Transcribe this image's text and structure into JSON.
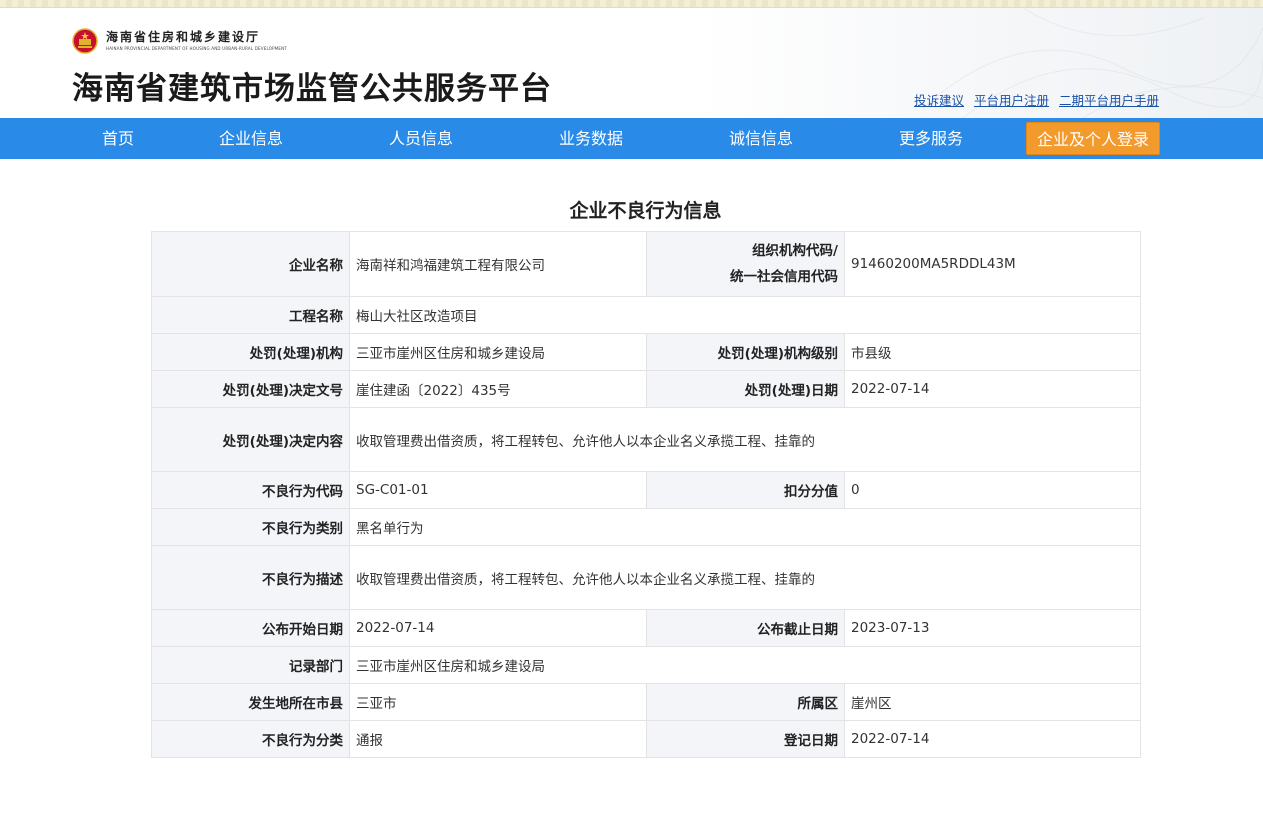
{
  "header": {
    "dept_name_cn": "海南省住房和城乡建设厅",
    "dept_name_en": "HAINAN PROVINCIAL DEPARTMENT OF HOUSING AND URBAN-RURAL DEVELOPMENT",
    "site_title": "海南省建筑市场监管公共服务平台",
    "links": [
      "投诉建议",
      "平台用户注册",
      "二期平台用户手册"
    ]
  },
  "nav": {
    "items": [
      "首页",
      "企业信息",
      "人员信息",
      "业务数据",
      "诚信信息",
      "更多服务"
    ],
    "login": "企业及个人登录"
  },
  "page": {
    "heading": "企业不良行为信息"
  },
  "labels": {
    "company_name": "企业名称",
    "org_code_line1": "组织机构代码/",
    "org_code_line2": "统一社会信用代码",
    "project_name": "工程名称",
    "penalty_agency": "处罚(处理)机构",
    "agency_level": "处罚(处理)机构级别",
    "decision_no": "处罚(处理)决定文号",
    "penalty_date": "处罚(处理)日期",
    "decision_content": "处罚(处理)决定内容",
    "behavior_code": "不良行为代码",
    "deduction": "扣分分值",
    "behavior_type": "不良行为类别",
    "behavior_desc": "不良行为描述",
    "publish_start": "公布开始日期",
    "publish_end": "公布截止日期",
    "record_dept": "记录部门",
    "city": "发生地所在市县",
    "district": "所属区",
    "classification": "不良行为分类",
    "register_date": "登记日期"
  },
  "values": {
    "company_name": "海南祥和鸿福建筑工程有限公司",
    "org_code": "91460200MA5RDDL43M",
    "project_name": "梅山大社区改造项目",
    "penalty_agency": "三亚市崖州区住房和城乡建设局",
    "agency_level": "市县级",
    "decision_no": "崖住建函〔2022〕435号",
    "penalty_date": "2022-07-14",
    "decision_content": "收取管理费出借资质，将工程转包、允许他人以本企业名义承揽工程、挂靠的",
    "behavior_code": "SG-C01-01",
    "deduction": "0",
    "behavior_type": "黑名单行为",
    "behavior_desc": "收取管理费出借资质，将工程转包、允许他人以本企业名义承揽工程、挂靠的",
    "publish_start": "2022-07-14",
    "publish_end": "2023-07-13",
    "record_dept": "三亚市崖州区住房和城乡建设局",
    "city": "三亚市",
    "district": "崖州区",
    "classification": "通报",
    "register_date": "2022-07-14"
  },
  "colors": {
    "nav_bg": "#2a8ae8",
    "login_bg": "#f39a2d",
    "label_bg": "#f3f5f9",
    "link": "#1a52a8"
  }
}
